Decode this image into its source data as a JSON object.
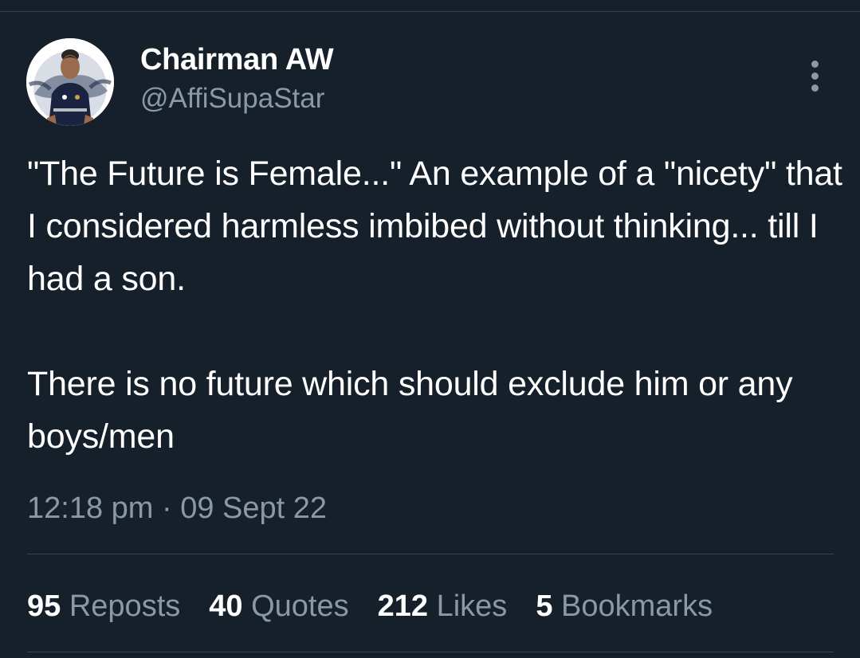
{
  "author": {
    "display_name": "Chairman AW",
    "handle": "@AffiSupaStar"
  },
  "tweet": {
    "paragraphs": [
      "\"The Future is Female...\" An example of a \"nicety\" that I considered harmless imbibed without thinking... till I had a son.",
      "There is no future which should exclude him or any boys/men"
    ],
    "timestamp": "12:18 pm · 09 Sept 22"
  },
  "stats": [
    {
      "count": "95",
      "label": "Reposts"
    },
    {
      "count": "40",
      "label": "Quotes"
    },
    {
      "count": "212",
      "label": "Likes"
    },
    {
      "count": "5",
      "label": "Bookmarks"
    }
  ],
  "icons": {
    "more": "more-vertical-icon"
  },
  "colors": {
    "background": "#15202b",
    "text": "#ffffff",
    "secondary_text": "#8b98a5",
    "divider": "#38444d"
  }
}
